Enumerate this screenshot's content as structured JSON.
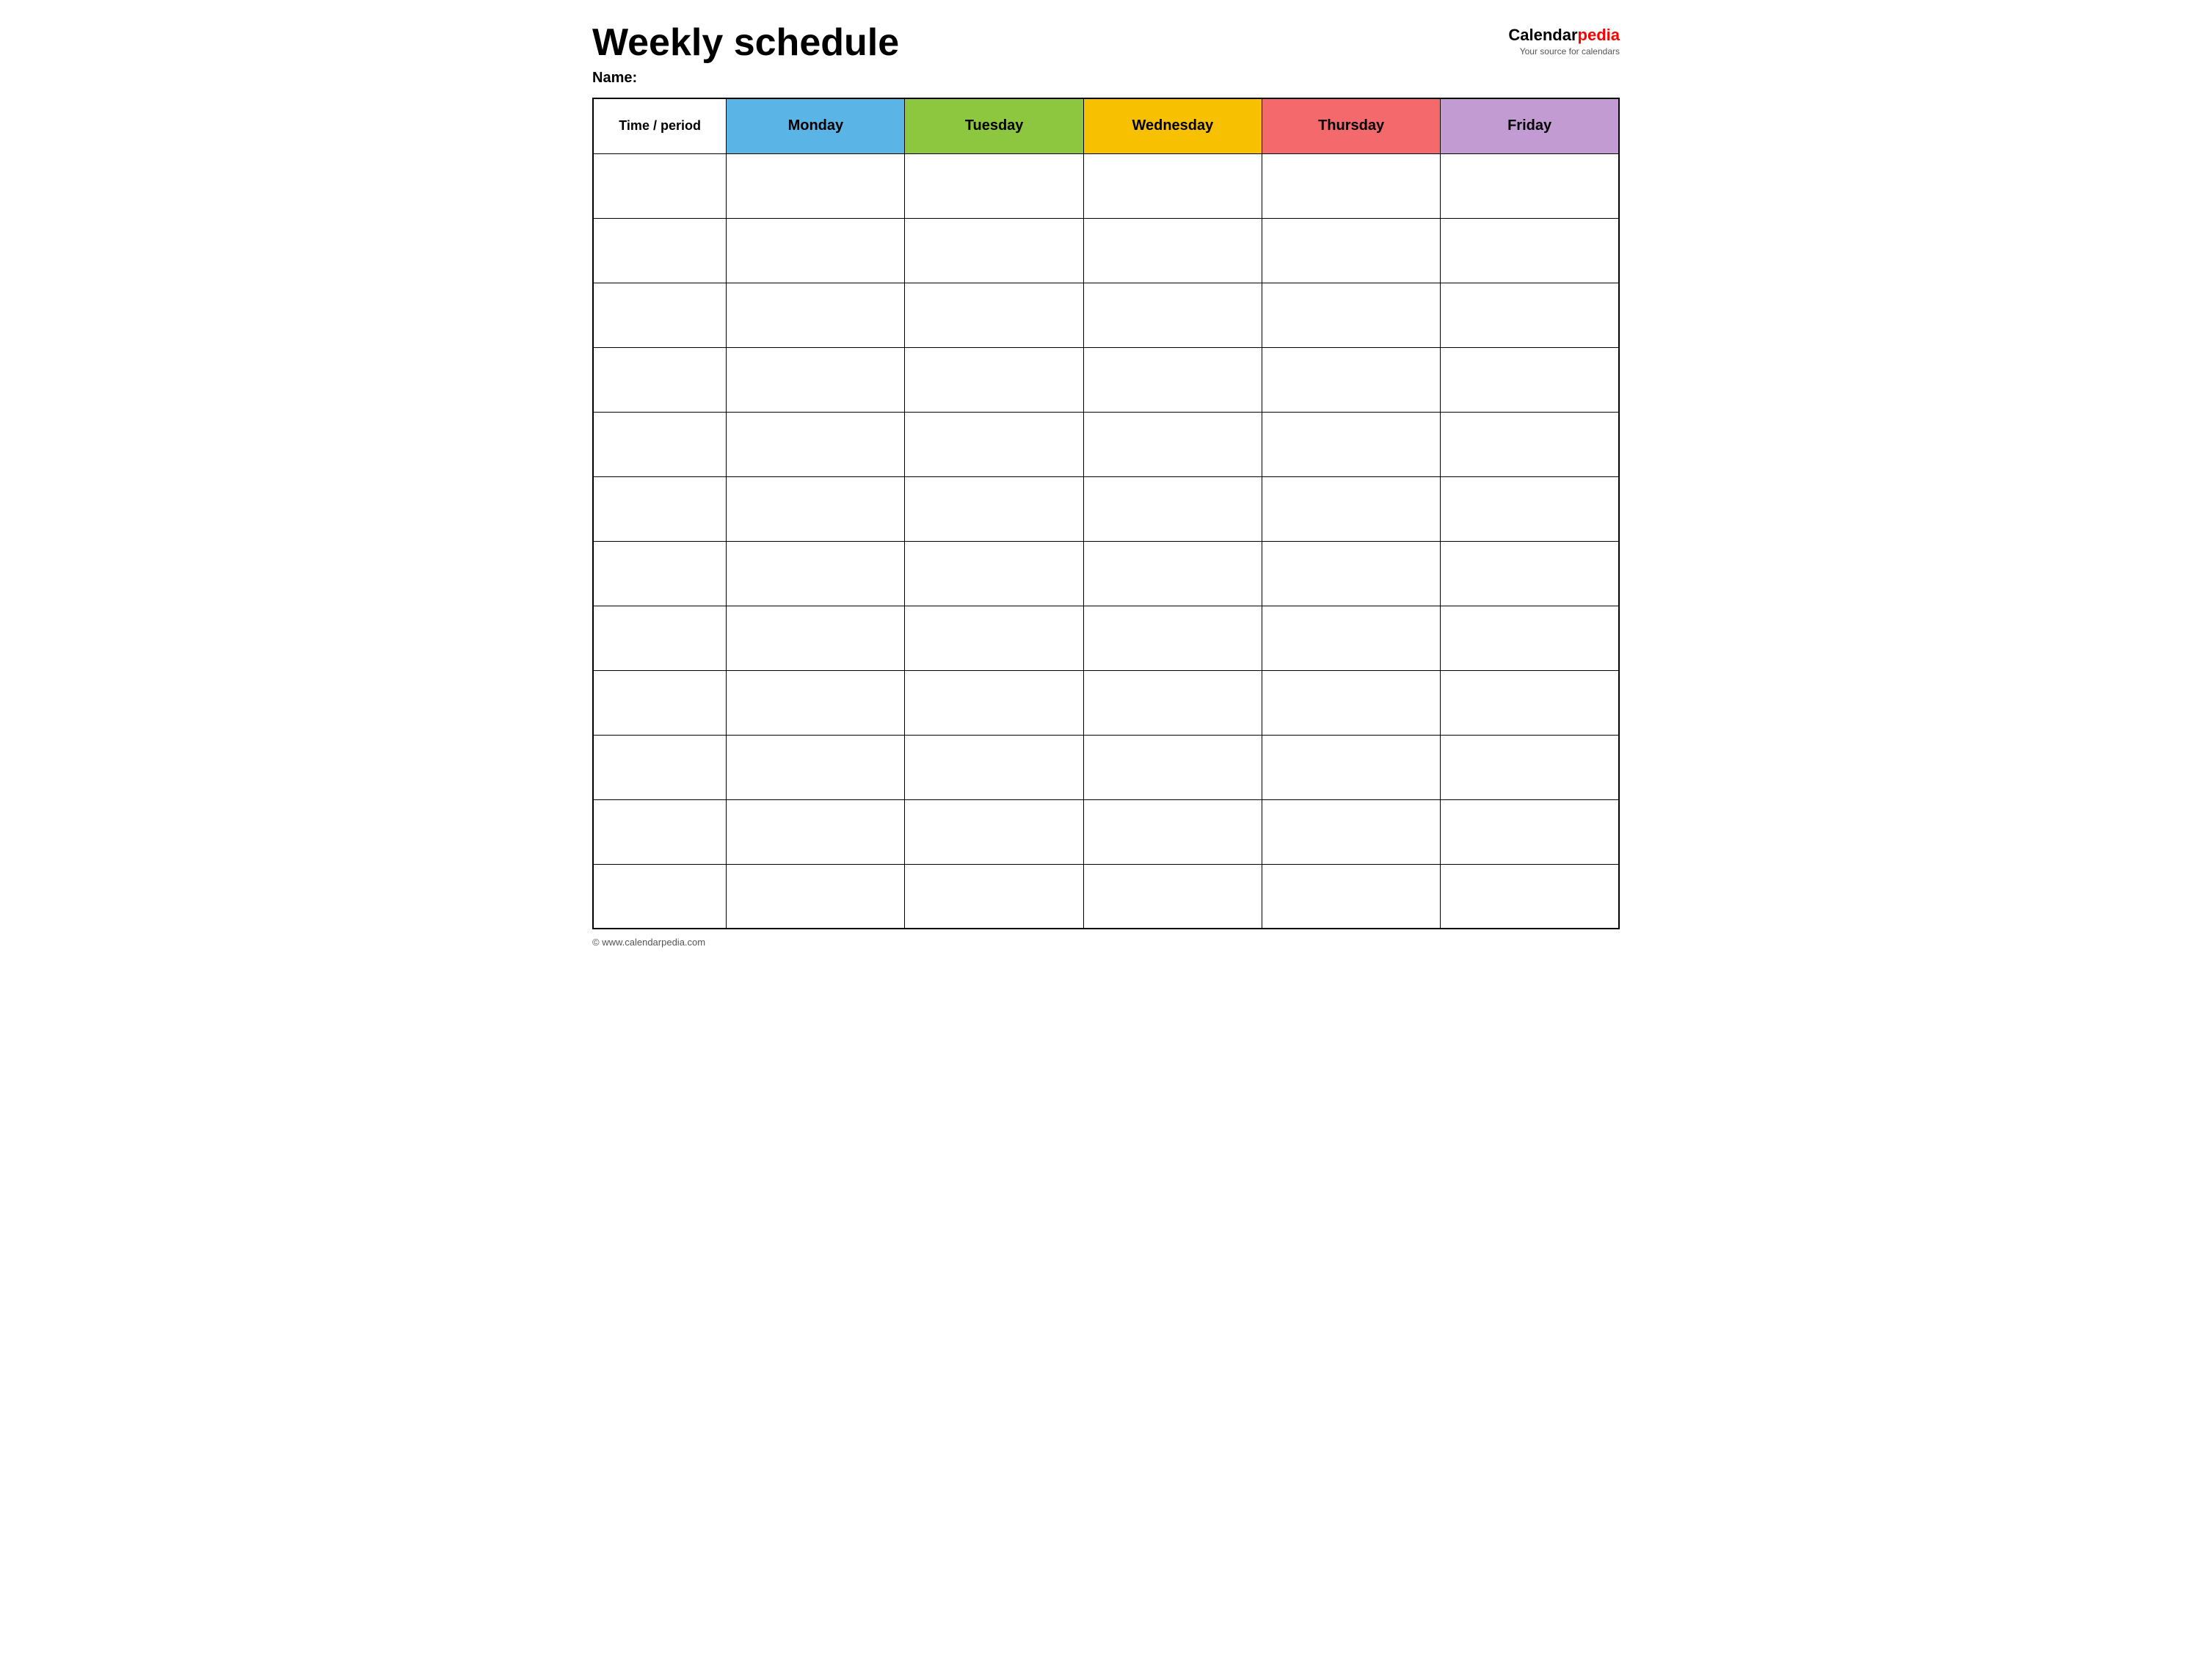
{
  "header": {
    "title": "Weekly schedule",
    "name_label": "Name:",
    "logo": {
      "calendar_part": "Calendar",
      "pedia_part": "pedia",
      "tagline": "Your source for calendars"
    }
  },
  "table": {
    "columns": [
      {
        "key": "time",
        "label": "Time / period",
        "color": "#ffffff"
      },
      {
        "key": "monday",
        "label": "Monday",
        "color": "#5ab4e5"
      },
      {
        "key": "tuesday",
        "label": "Tuesday",
        "color": "#8dc63f"
      },
      {
        "key": "wednesday",
        "label": "Wednesday",
        "color": "#f7c000"
      },
      {
        "key": "thursday",
        "label": "Thursday",
        "color": "#f4696b"
      },
      {
        "key": "friday",
        "label": "Friday",
        "color": "#c39bd3"
      }
    ],
    "row_count": 12
  },
  "footer": {
    "copyright": "© www.calendarpedia.com"
  }
}
